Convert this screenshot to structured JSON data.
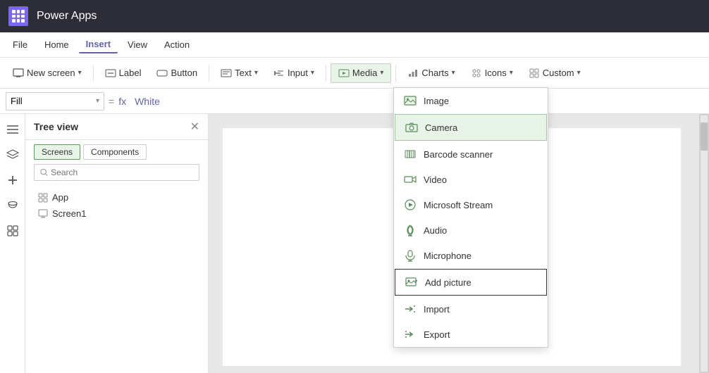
{
  "titleBar": {
    "appName": "Power Apps"
  },
  "menuBar": {
    "items": [
      {
        "label": "File",
        "active": false
      },
      {
        "label": "Home",
        "active": false
      },
      {
        "label": "Insert",
        "active": true
      },
      {
        "label": "View",
        "active": false
      },
      {
        "label": "Action",
        "active": false
      }
    ]
  },
  "toolbar": {
    "newScreen": "New screen",
    "label": "Label",
    "button": "Button",
    "text": "Text",
    "input": "Input",
    "media": "Media",
    "charts": "Charts",
    "icons": "Icons",
    "custom": "Custom"
  },
  "formulaBar": {
    "property": "Fill",
    "value": "White"
  },
  "treeView": {
    "title": "Tree view",
    "tabs": [
      {
        "label": "Screens",
        "active": true
      },
      {
        "label": "Components",
        "active": false
      }
    ],
    "searchPlaceholder": "Search",
    "items": [
      {
        "label": "App",
        "icon": "app"
      },
      {
        "label": "Screen1",
        "icon": "screen"
      }
    ]
  },
  "mediaDropdown": {
    "items": [
      {
        "label": "Image",
        "highlighted": false,
        "addPicture": false
      },
      {
        "label": "Camera",
        "highlighted": true,
        "addPicture": false
      },
      {
        "label": "Barcode scanner",
        "highlighted": false,
        "addPicture": false
      },
      {
        "label": "Video",
        "highlighted": false,
        "addPicture": false
      },
      {
        "label": "Microsoft Stream",
        "highlighted": false,
        "addPicture": false
      },
      {
        "label": "Audio",
        "highlighted": false,
        "addPicture": false
      },
      {
        "label": "Microphone",
        "highlighted": false,
        "addPicture": false
      },
      {
        "label": "Add picture",
        "highlighted": false,
        "addPicture": true
      },
      {
        "label": "Import",
        "highlighted": false,
        "addPicture": false
      },
      {
        "label": "Export",
        "highlighted": false,
        "addPicture": false
      }
    ]
  }
}
